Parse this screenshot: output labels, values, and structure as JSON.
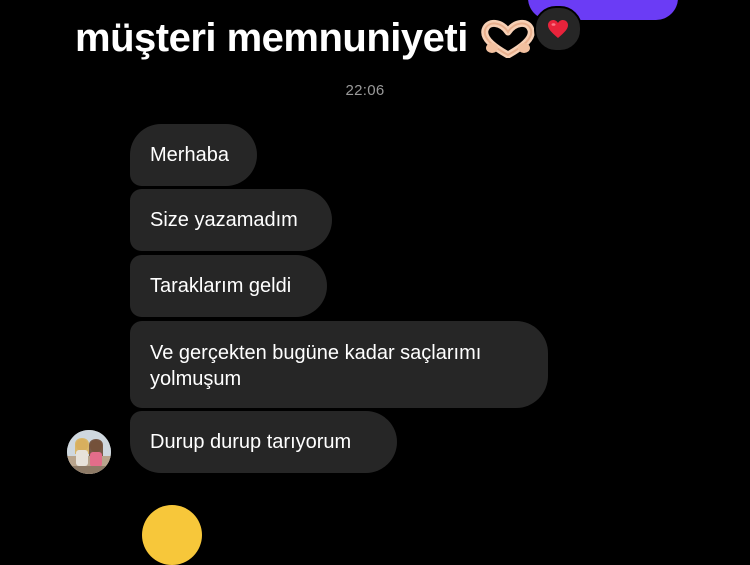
{
  "message_thread": {
    "sent_caption": "müşteri memnuniyeti",
    "sent_caption_emoji": "heart-hands-emoji",
    "reaction_emoji": "red-heart-emoji",
    "timestamp": "22:06",
    "received_messages": [
      {
        "text": "Merhaba"
      },
      {
        "text": "Size yazamadım"
      },
      {
        "text": "Taraklarım geldi"
      },
      {
        "text": "Ve gerçekten bugüne kadar saçlarımı yolmuşum"
      },
      {
        "text": "Durup durup tarıyorum"
      }
    ]
  },
  "colors": {
    "background": "#000000",
    "received_bubble": "#262626",
    "sent_bubble": "#6b3cf5",
    "timestamp_text": "#9a9a9a",
    "reaction_heart": "#e8233b"
  }
}
